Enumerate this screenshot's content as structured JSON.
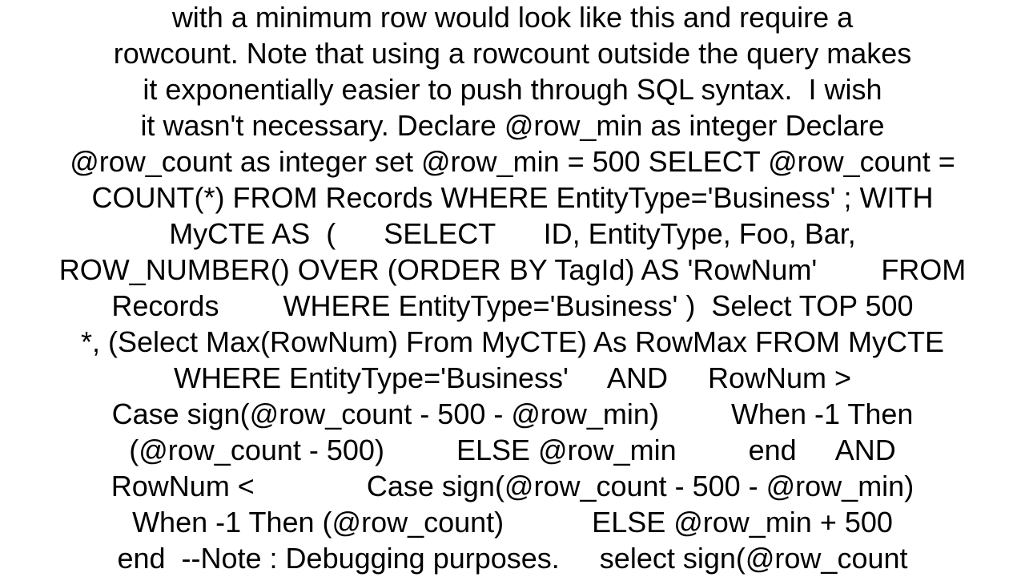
{
  "document": {
    "lines": [
      "with a minimum row would look like this and require a",
      "rowcount. Note that using a rowcount outside the query makes",
      "it exponentially easier to push through SQL syntax.  I wish",
      "it wasn't necessary. Declare @row_min as integer Declare",
      "@row_count as integer set @row_min = 500 SELECT @row_count =",
      "COUNT(*) FROM Records WHERE EntityType='Business' ; WITH",
      "MyCTE AS  (      SELECT      ID, EntityType, Foo, Bar,",
      "ROW_NUMBER() OVER (ORDER BY TagId) AS 'RowNum'        FROM",
      "Records        WHERE EntityType='Business' )  Select TOP 500",
      "*, (Select Max(RowNum) From MyCTE) As RowMax FROM MyCTE",
      "WHERE EntityType='Business'     AND     RowNum >",
      "Case sign(@row_count - 500 - @row_min)         When -1 Then",
      "(@row_count - 500)         ELSE @row_min         end     AND",
      "RowNum <              Case sign(@row_count - 500 - @row_min)",
      "When -1 Then (@row_count)           ELSE @row_min + 500",
      "end  --Note : Debugging purposes.     select sign(@row_count"
    ]
  }
}
